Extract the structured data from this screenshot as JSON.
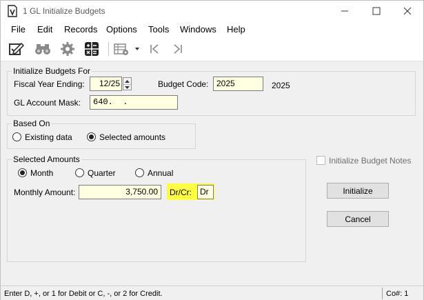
{
  "window": {
    "title": "1 GL Initialize Budgets",
    "icon": "document-v-icon"
  },
  "menu": [
    "File",
    "Edit",
    "Records",
    "Options",
    "Tools",
    "Windows",
    "Help"
  ],
  "toolbar": {
    "icons": [
      "edit-check-icon",
      "binoculars-icon",
      "gear-icon",
      "calculator-icon",
      "table-settings-icon",
      "dropdown-arrow-icon",
      "first-record-icon",
      "last-record-icon"
    ]
  },
  "init_group": {
    "label": "Initialize Budgets For",
    "fiscal_year_label": "Fiscal Year Ending:",
    "fiscal_year_value": "12/25",
    "budget_code_label": "Budget Code:",
    "budget_code_value": "2025",
    "budget_code_desc": "2025",
    "gl_mask_label": "GL Account Mask:",
    "gl_mask_value": "640.  ."
  },
  "based_on": {
    "label": "Based On",
    "options": [
      "Existing data",
      "Selected amounts"
    ],
    "selected": "Selected amounts"
  },
  "selected_amounts": {
    "label": "Selected Amounts",
    "periods": [
      "Month",
      "Quarter",
      "Annual"
    ],
    "selected": "Month",
    "amount_label": "Monthly Amount:",
    "amount_value": "3,750.00",
    "drcr_label": "Dr/Cr:",
    "drcr_value": "Dr"
  },
  "notes_checkbox": {
    "label": "Initialize Budget Notes",
    "checked": false
  },
  "buttons": {
    "initialize": "Initialize",
    "cancel": "Cancel"
  },
  "status": {
    "message": "Enter D, +, or 1 for Debit or C, -, or 2 for Credit.",
    "company": "Co#: 1"
  },
  "colors": {
    "field_bg": "#ffffe1",
    "highlight": "#ffff40"
  }
}
